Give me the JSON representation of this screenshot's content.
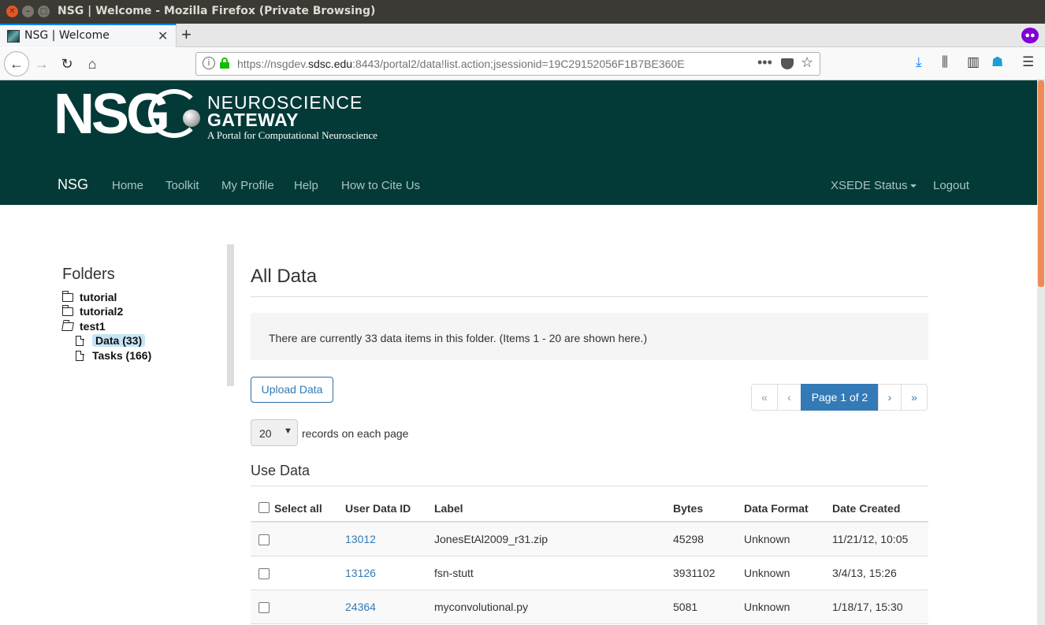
{
  "window": {
    "title": "NSG | Welcome - Mozilla Firefox (Private Browsing)"
  },
  "browser": {
    "tab_title": "NSG | Welcome",
    "url_host_prefix": "https://nsgdev.",
    "url_host_domain": "sdsc.edu",
    "url_rest": ":8443/portal2/data!list.action;jsessionid=19C29152056F1B7BE360E",
    "extension_badge": "0"
  },
  "site": {
    "logo_text": "NSG",
    "logo_line1": "NEUROSCIENCE",
    "logo_line2": "GATEWAY",
    "logo_line3": "A Portal for Computational Neuroscience",
    "nav": {
      "brand": "NSG",
      "home": "Home",
      "toolkit": "Toolkit",
      "profile": "My Profile",
      "help": "Help",
      "cite": "How to Cite Us",
      "xsede": "XSEDE Status",
      "logout": "Logout"
    },
    "header_color": "#033a37"
  },
  "sidebar": {
    "title": "Folders",
    "folders": [
      "tutorial",
      "tutorial2",
      "test1"
    ],
    "sub_items": [
      "Data (33)",
      "Tasks (166)"
    ]
  },
  "main": {
    "title": "All Data",
    "info_text": "There are currently 33 data items in this folder. (Items 1 - 20 are shown here.)",
    "upload_label": "Upload Data",
    "pager": {
      "first": "«",
      "prev": "‹",
      "current": "Page 1 of 2",
      "next": "›",
      "last": "»"
    },
    "records_select": "20",
    "records_label": "records on each page",
    "section_title": "Use Data",
    "table": {
      "headers": [
        "Select all",
        "User Data ID",
        "Label",
        "Bytes",
        "Data Format",
        "Date Created"
      ],
      "rows": [
        {
          "id": "13012",
          "label": "JonesEtAl2009_r31.zip",
          "bytes": "45298",
          "format": "Unknown",
          "date": "11/21/12, 10:05"
        },
        {
          "id": "13126",
          "label": "fsn-stutt",
          "bytes": "3931102",
          "format": "Unknown",
          "date": "3/4/13, 15:26"
        },
        {
          "id": "24364",
          "label": "myconvolutional.py",
          "bytes": "5081",
          "format": "Unknown",
          "date": "1/18/17, 15:30"
        }
      ]
    }
  }
}
